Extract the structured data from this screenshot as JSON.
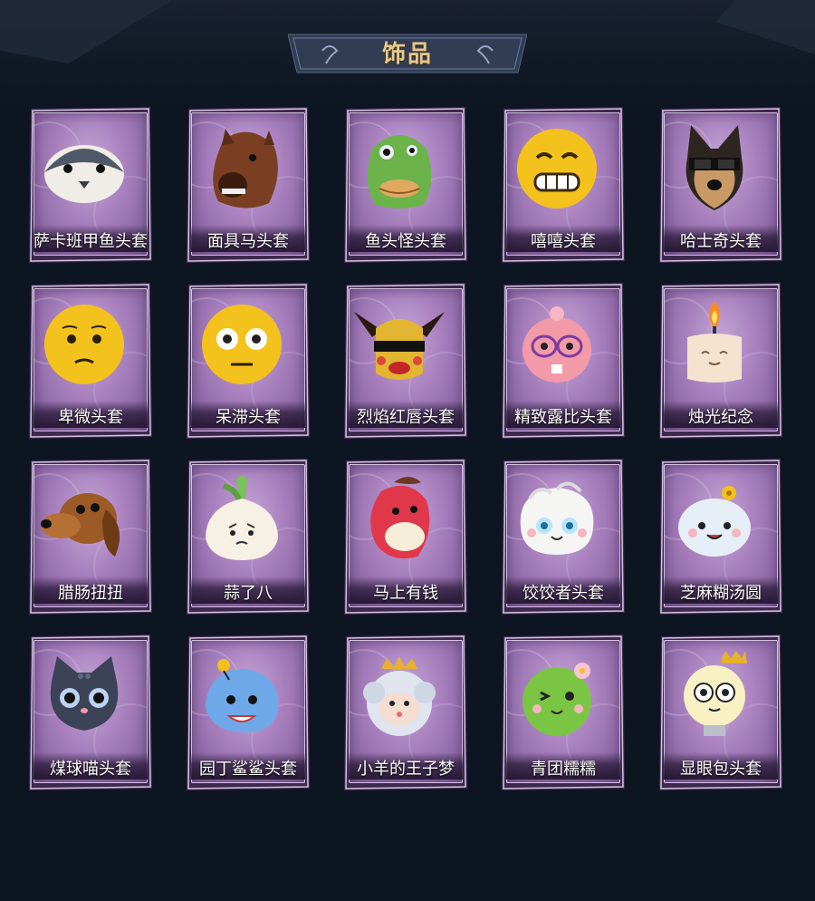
{
  "header": {
    "title": "饰品"
  },
  "items": [
    {
      "label": "萨卡班甲鱼头套",
      "icon": "fish-head-icon"
    },
    {
      "label": "面具马头套",
      "icon": "horse-head-icon"
    },
    {
      "label": "鱼头怪头套",
      "icon": "fish-monster-head-icon"
    },
    {
      "label": "嘻嘻头套",
      "icon": "grinning-face-icon"
    },
    {
      "label": "哈士奇头套",
      "icon": "husky-head-icon"
    },
    {
      "label": "卑微头套",
      "icon": "pleading-face-icon"
    },
    {
      "label": "呆滞头套",
      "icon": "dazed-face-icon"
    },
    {
      "label": "烈焰红唇头套",
      "icon": "red-lips-head-icon"
    },
    {
      "label": "精致露比头套",
      "icon": "ruby-beaver-head-icon"
    },
    {
      "label": "烛光纪念",
      "icon": "candle-head-icon"
    },
    {
      "label": "腊肠扭扭",
      "icon": "dachshund-head-icon"
    },
    {
      "label": "蒜了八",
      "icon": "garlic-head-icon"
    },
    {
      "label": "马上有钱",
      "icon": "red-horse-head-icon"
    },
    {
      "label": "饺饺者头套",
      "icon": "dumpling-head-icon"
    },
    {
      "label": "芝麻糊汤圆",
      "icon": "tangyuan-head-icon"
    },
    {
      "label": "煤球喵头套",
      "icon": "black-cat-head-icon"
    },
    {
      "label": "园丁鲨鲨头套",
      "icon": "shark-head-icon"
    },
    {
      "label": "小羊的王子梦",
      "icon": "crowned-sheep-head-icon"
    },
    {
      "label": "青团糯糯",
      "icon": "green-dumpling-head-icon"
    },
    {
      "label": "显眼包头套",
      "icon": "lightbulb-head-icon"
    }
  ],
  "colors": {
    "accent": "#e8c98a",
    "card": "#a77fbd",
    "background": "#0e1522"
  }
}
